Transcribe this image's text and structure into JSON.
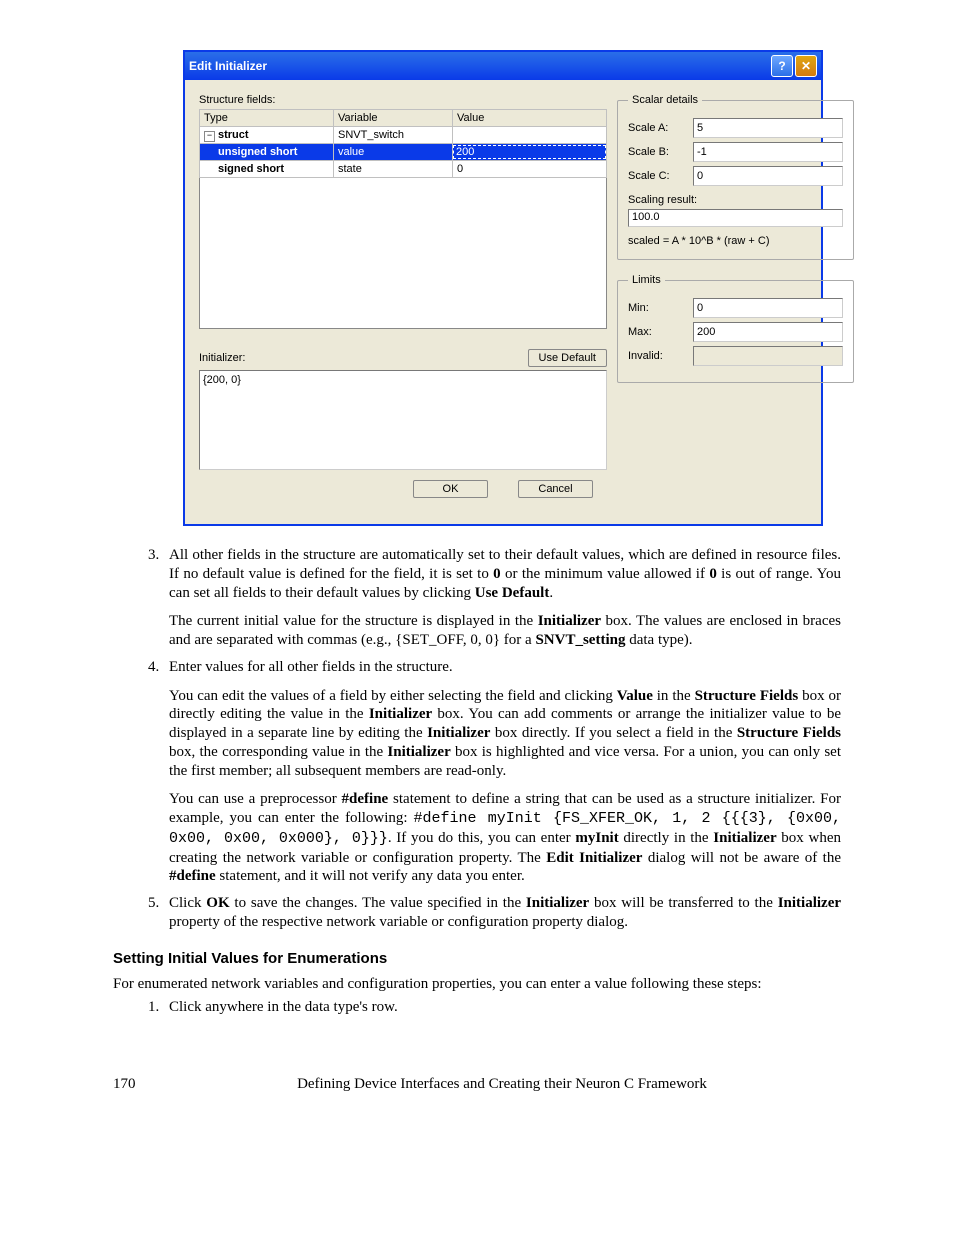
{
  "dialog": {
    "title": "Edit Initializer",
    "structure_fields_label": "Structure fields:",
    "columns": {
      "type": "Type",
      "variable": "Variable",
      "value": "Value"
    },
    "rows": [
      {
        "type_prefix": "⊟",
        "type": "struct",
        "variable": "SNVT_switch",
        "value": "",
        "selected": false,
        "indent": 0
      },
      {
        "type_prefix": "",
        "type": "unsigned short",
        "variable": "value",
        "value": "200",
        "selected": true,
        "indent": 1
      },
      {
        "type_prefix": "",
        "type": "signed short",
        "variable": "state",
        "value": "0",
        "selected": false,
        "indent": 1
      }
    ],
    "initializer_label": "Initializer:",
    "use_default_label": "Use Default",
    "initializer_value": "{200, 0}",
    "scalar": {
      "legend": "Scalar details",
      "scale_a_label": "Scale A:",
      "scale_a": "5",
      "scale_b_label": "Scale B:",
      "scale_b": "-1",
      "scale_c_label": "Scale C:",
      "scale_c": "0",
      "result_label": "Scaling result:",
      "result": "100.0",
      "formula": "scaled = A * 10^B * (raw + C)"
    },
    "limits": {
      "legend": "Limits",
      "min_label": "Min:",
      "min": "0",
      "max_label": "Max:",
      "max": "200",
      "invalid_label": "Invalid:",
      "invalid": ""
    },
    "ok_label": "OK",
    "cancel_label": "Cancel"
  },
  "doc": {
    "item3_a": "All other fields in the structure are automatically set to their default values, which are defined in resource files.  If no default value is defined for the field, it is set to ",
    "item3_b": " or the minimum value allowed if ",
    "item3_c": " is out of range.  You can set all fields to their default values by clicking ",
    "item3_bold0": "0",
    "item3_bold0b": "0",
    "item3_use_default": "Use Default",
    "item3_p_a": "The current initial value for the structure is displayed in the ",
    "item3_p_b": " box.  The values are enclosed in braces and are separated with commas (e.g., {SET_OFF, 0, 0} for a ",
    "item3_p_c": " data type).",
    "item3_p_bold_init": "Initializer",
    "item3_p_bold_snvt": "SNVT_setting",
    "item4_a": "Enter values for all other fields in the structure.",
    "item4_p1_a": "You can edit the values of a field by either selecting the field and clicking ",
    "item4_p1_b": " in the ",
    "item4_p1_c": " box or directly editing the value in the ",
    "item4_p1_d": " box.  You can add comments or arrange the initializer value to be displayed in a separate line by editing the ",
    "item4_p1_e": " box directly.  If you select a field in the ",
    "item4_p1_f": " box, the corresponding value in the ",
    "item4_p1_g": " box is highlighted and vice versa.  For a union, you can only set the first member; all subsequent members are read-only.",
    "item4_p1_value": "Value",
    "item4_p1_sf": "Structure Fields",
    "item4_p1_init": "Initializer",
    "item4_p2_a": "You can use a preprocessor ",
    "item4_p2_b": " statement to define a string that can be used as a structure initializer.  For example, you can enter the following: ",
    "item4_p2_c": ". If you do this, you can enter ",
    "item4_p2_d": " directly in the ",
    "item4_p2_e": " box when creating the network variable or configuration property.  The ",
    "item4_p2_f": " dialog will not be aware of the ",
    "item4_p2_g": " statement, and it will not verify any data you enter.",
    "item4_p2_define": "#define",
    "item4_p2_code": "#define myInit {FS_XFER_OK, 1, 2 {{{3}, {0x00, 0x00, 0x00, 0x000}, 0}}}",
    "item4_p2_myinit": "myInit",
    "item4_p2_init": "Initializer",
    "item4_p2_edit": "Edit Initializer",
    "item5_a": "Click ",
    "item5_b": " to save the changes.  The value specified in the ",
    "item5_c": " box will be transferred to the ",
    "item5_d": " property of the respective network variable or configuration property dialog.",
    "item5_ok": "OK",
    "item5_init": "Initializer",
    "heading": "Setting Initial Values for Enumerations",
    "para": "For enumerated network variables and configuration properties, you can enter a value following these steps:",
    "step1": "Click anywhere in the data type's row.",
    "page_num": "170",
    "footer": "Defining Device Interfaces and Creating their Neuron C Framework"
  }
}
